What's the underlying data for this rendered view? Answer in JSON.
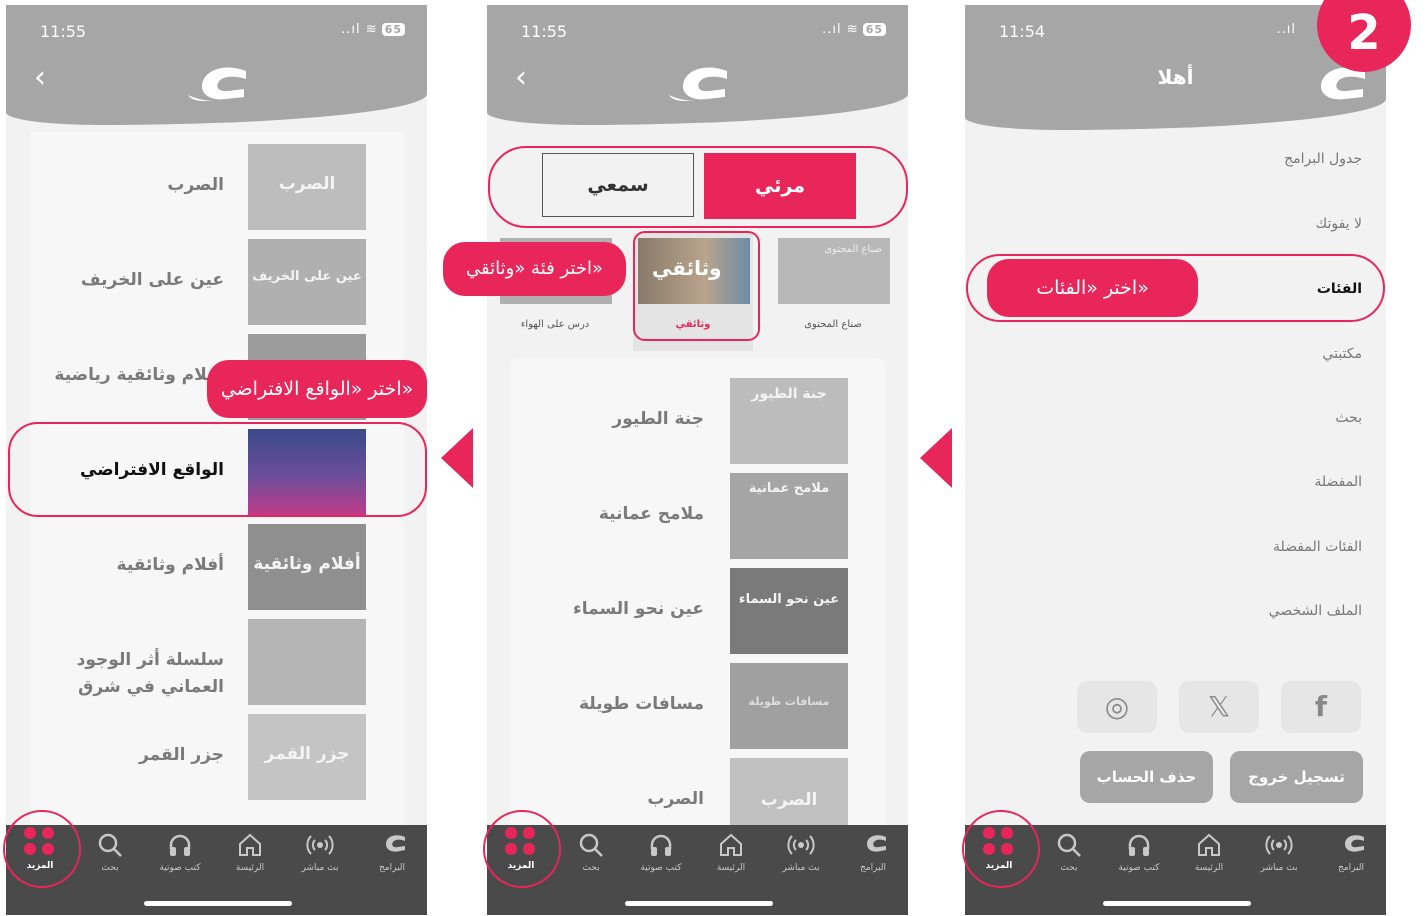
{
  "colors": {
    "accent": "#e8265a",
    "header": "#a6a6a6",
    "tabbar": "#4a4a4a"
  },
  "step_number": "2",
  "status": {
    "phone1_time": "11:55",
    "phone2_time": "11:55",
    "phone3_time": "11:54",
    "signal": "..ıl",
    "wifi": "≋",
    "battery": "65"
  },
  "tabbar": {
    "more": "المزيد",
    "search": "بحث",
    "audiobooks": "كتب صوتية",
    "home": "الرئيسة",
    "live": "بث مباشر",
    "programs": "البرامج"
  },
  "phone1": {
    "items": [
      "الصرب",
      "عين على الخريف",
      "أفلام وثائقية رياضية",
      "الواقع الافتراضي",
      "أفلام وثائقية",
      "سلسلة أثر الوجود العماني في شرق",
      "جزر القمر"
    ],
    "thumb_texts": [
      "الصرب",
      "عين على الخريف",
      "",
      "",
      "أفلام وثائقية",
      "",
      "جزر القمر"
    ],
    "callout": "اختر «الواقع الافتراضي»"
  },
  "phone2": {
    "segments": {
      "visual": "مرئي",
      "audio": "سمعي"
    },
    "categories": [
      "صناع المحتوى",
      "وثائقي",
      "درس على الهواء"
    ],
    "cat_thumb_texts": [
      "صناع المحتوى",
      "وثائقي",
      ""
    ],
    "items": [
      "جنة الطيور",
      "ملامح عمانية",
      "عين نحو السماء",
      "مسافات طويلة",
      "الصرب"
    ],
    "thumb_texts": [
      "جنة الطيور",
      "ملامح عمانية",
      "عين نحو السماء",
      "مسافات طويلة",
      "الصرب"
    ],
    "callout": "اختر فئة «وثائقي»"
  },
  "phone3": {
    "greeting": "أهلا",
    "menu": [
      "جدول البرامج",
      "لا يفوتك",
      "الفئات",
      "مكتبتي",
      "بحث",
      "المفضلة",
      "الفئات المفضلة",
      "الملف الشخصي"
    ],
    "social": {
      "instagram": "◎",
      "x": "𝕏",
      "facebook": "f"
    },
    "logout": "تسجيل خروج",
    "delete_account": "حذف الحساب",
    "callout": "اختر «الفئات»"
  }
}
